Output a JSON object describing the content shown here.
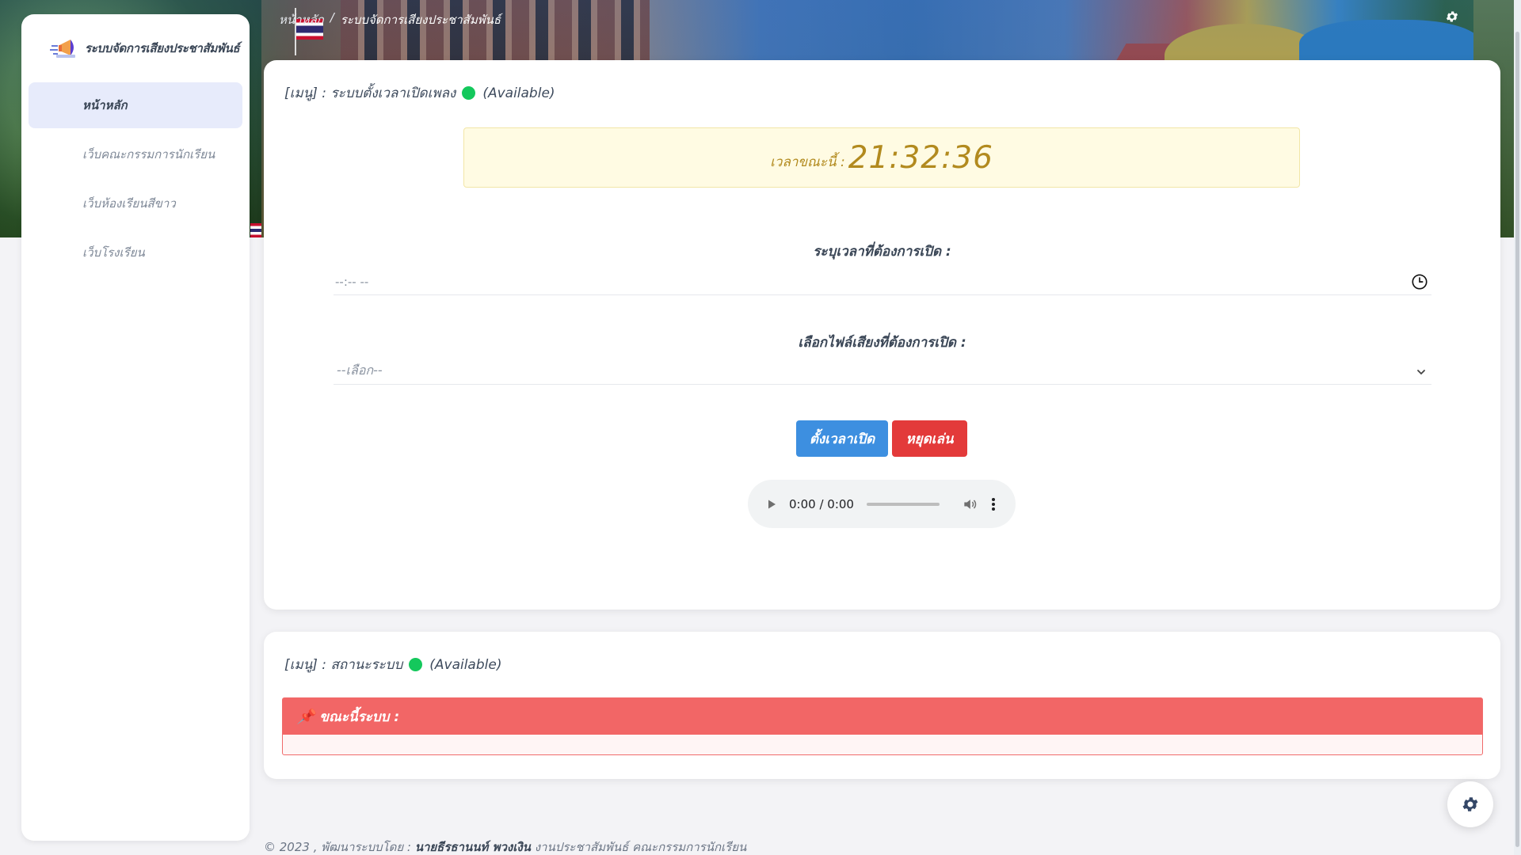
{
  "brand": {
    "name": "ระบบจัดการเสียงประชาสัมพันธ์",
    "logo_icon": "megaphone-icon"
  },
  "sidebar": {
    "items": [
      {
        "label": "หน้าหลัก",
        "active": true
      },
      {
        "label": "เว็บคณะกรรมการนักเรียน",
        "active": false
      },
      {
        "label": "เว็บห้องเรียนสีขาว",
        "active": false
      },
      {
        "label": "เว็บโรงเรียน",
        "active": false
      }
    ]
  },
  "breadcrumb": {
    "home": "หน้าหลัก",
    "separator": "/",
    "current": "ระบบจัดการเสียงประชาสัมพันธ์"
  },
  "scheduler": {
    "title": "[เมนู] : ระบบตั้งเวลาเปิดเพลง",
    "status": "(Available)",
    "status_color": "#14c85c",
    "clock_label": "เวลาขณะนี้ :",
    "clock_time": "21:32:36",
    "time_label": "ระบุเวลาที่ต้องการเปิด :",
    "time_placeholder": "--:-- --",
    "file_label": "เลือกไฟล์เสียงที่ต้องการเปิด :",
    "file_selected": "--เลือก--",
    "set_button": "ตั้งเวลาเปิด",
    "stop_button": "หยุดเล่น",
    "audio_time": "0:00 / 0:00"
  },
  "system_status": {
    "title": "[เมนู] : สถานะระบบ",
    "status": "(Available)",
    "status_color": "#14c85c",
    "current_label": "ขณะนี้ระบบ :",
    "current_value": ""
  },
  "footer": {
    "prefix": "© 2023 , พัฒนาระบบโดย :",
    "author": "นายธีรธานนท์ พวงเงิน",
    "suffix": "งานประชาสัมพันธ์ คณะกรรมการนักเรียน"
  },
  "colors": {
    "primary": "#3d8fe0",
    "danger": "#e33a3a",
    "status_header": "#f26666"
  }
}
